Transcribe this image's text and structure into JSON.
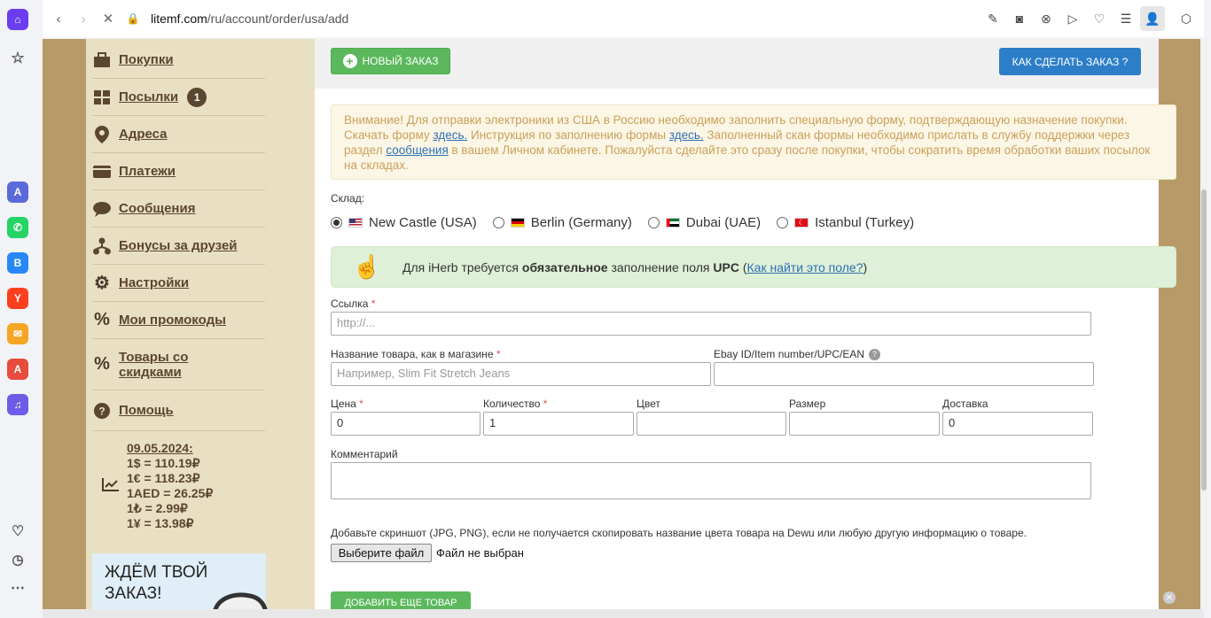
{
  "browser": {
    "url_host": "litemf.com",
    "url_path": "/ru/account/order/usa/add"
  },
  "sidebar": {
    "items": [
      {
        "label": "Покупки",
        "icon": "bag-icon"
      },
      {
        "label": "Посылки",
        "icon": "boxes-icon",
        "badge": "1"
      },
      {
        "label": "Адреса",
        "icon": "map-pin-icon"
      },
      {
        "label": "Платежи",
        "icon": "wallet-icon"
      },
      {
        "label": "Сообщения",
        "icon": "chat-icon"
      },
      {
        "label": "Бонусы за друзей",
        "icon": "network-icon"
      },
      {
        "label": "Настройки",
        "icon": "gear-icon"
      },
      {
        "label": "Мои промокоды",
        "icon": "percent-icon"
      },
      {
        "label": "Товары со скидками",
        "icon": "percent-icon"
      },
      {
        "label": "Помощь",
        "icon": "help-icon"
      }
    ],
    "rates": {
      "date": "09.05.2024:",
      "usd": "1$ = 110.19₽",
      "eur": "1€ = 118.23₽",
      "aed": "1AED = 26.25₽",
      "try": "1₺ = 2.99₽",
      "cny": "1¥ = 13.98₽"
    },
    "promo_text": "ЖДЁМ ТВОЙ ЗАКАЗ!"
  },
  "header": {
    "new_order": "НОВЫЙ ЗАКАЗ",
    "how_to": "КАК СДЕЛАТЬ ЗАКАЗ ?"
  },
  "warning": {
    "part1": "Внимание! Для отправки электроники из США в Россию необходимо заполнить специальную форму, подтверждающую назначение покупки. Скачать форму ",
    "link1": "здесь.",
    "part2": " Инструкция по заполнению формы ",
    "link2": "здесь.",
    "part3": " Заполненный скан формы необходимо прислать в службу поддержки через раздел ",
    "link3": "сообщения",
    "part4": " в вашем Личном кабинете. Пожалуйста сделайте это сразу после покупки, чтобы сократить время обработки ваших посылок на складах."
  },
  "warehouse": {
    "label": "Склад:",
    "options": [
      {
        "label": "New Castle (USA)",
        "selected": true
      },
      {
        "label": "Berlin (Germany)",
        "selected": false
      },
      {
        "label": "Dubai (UAE)",
        "selected": false
      },
      {
        "label": "Istanbul (Turkey)",
        "selected": false
      }
    ]
  },
  "iherb": {
    "pre": "Для iHerb требуется ",
    "bold1": "обязательное",
    "mid": " заполнение поля ",
    "bold2": "UPC",
    "open": " (",
    "link": "Как найти это поле?",
    "close": ")"
  },
  "form": {
    "link_label": "Ссылка",
    "link_placeholder": "http://...",
    "name_label": "Название товара, как в магазине",
    "name_placeholder": "Например, Slim Fit Stretch Jeans",
    "ebay_label": "Ebay ID/Item number/UPC/EAN",
    "price_label": "Цена",
    "price_value": "0",
    "qty_label": "Количество",
    "qty_value": "1",
    "color_label": "Цвет",
    "size_label": "Размер",
    "delivery_label": "Доставка",
    "delivery_value": "0",
    "comment_label": "Комментарий",
    "screenshot_note": "Добавьте скриншот (JPG, PNG), если не получается скопировать название цвета товара на Dewu или любую другую информацию о товаре.",
    "file_button": "Выберите файл",
    "file_status": "Файл не выбран",
    "add_more": "ДОБАВИТЬ ЕЩЕ ТОВАР"
  }
}
